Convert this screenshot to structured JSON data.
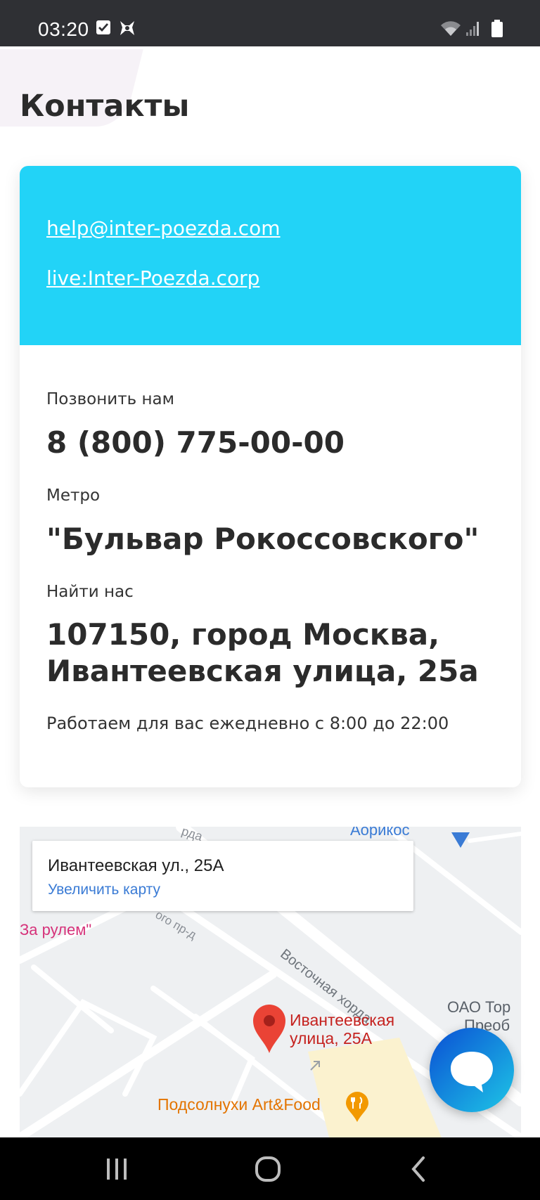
{
  "status_bar": {
    "time": "03:20",
    "icons": [
      "checkbox-icon",
      "bug-icon",
      "wifi-icon",
      "signal-icon",
      "battery-icon"
    ]
  },
  "page": {
    "title": "Контакты"
  },
  "contacts": {
    "email": "help@inter-poezda.com",
    "skype": "live:Inter-Poezda.corp",
    "call_label": "Позвонить нам",
    "phone": "8 (800) 775-00-00",
    "metro_label": "Метро",
    "metro": "\"Бульвар Рокоссовского\"",
    "find_label": "Найти нас",
    "address_line1": "107150, город Москва,",
    "address_line2": "Ивантеевская улица, 25а",
    "hours": "Работаем для вас ежедневно с 8:00 до 22:00"
  },
  "map": {
    "info_title": "Ивантеевская ул., 25А",
    "info_link": "Увеличить карту",
    "pin_label_line1": "Ивантеевская",
    "pin_label_line2": "улица, 25А",
    "labels": {
      "vostochnaya": "Восточная хорда",
      "za_rulem": "За рулем\"",
      "oao_line1": "ОАО Тор",
      "oao_line2": "Преоб",
      "podsolnuhi": "Подсолнухи Art&Food",
      "aurikos": "Аорикос",
      "top_road": "рда",
      "side_road": "ого пр-д"
    }
  },
  "colors": {
    "accent": "#22d3f7",
    "pin": "#ea4335",
    "chat_gradient_start": "#0a4fd4",
    "chat_gradient_end": "#1ec6e6"
  },
  "nav": {
    "icons": [
      "recent-apps-icon",
      "home-icon",
      "back-icon"
    ]
  }
}
